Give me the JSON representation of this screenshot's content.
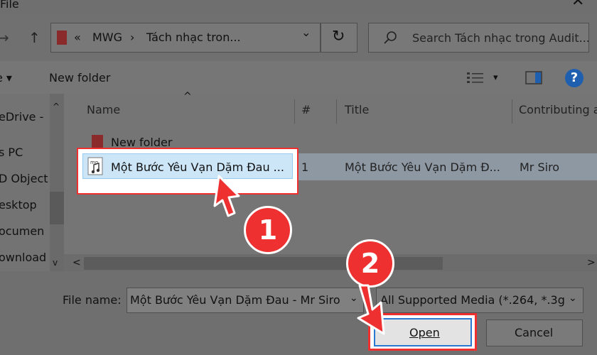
{
  "window": {
    "title": "File",
    "close": "✕"
  },
  "nav": {
    "back": "←",
    "forward": "→",
    "up": "↑"
  },
  "address": {
    "chevron": "«",
    "seg1": "MWG",
    "sep": "›",
    "seg2": "Tách nhạc tron...",
    "dropdown": "⌄",
    "refresh": "↻"
  },
  "search": {
    "placeholder": "Search Tách nhạc trong Audit..."
  },
  "toolbar": {
    "organize": "e ▾",
    "new_folder": "New folder",
    "view_menu": "▾",
    "help": "?"
  },
  "sidebar": {
    "items": [
      "eDrive -",
      "s PC",
      "D Object",
      "esktop",
      "ocumen",
      "ownload"
    ]
  },
  "columns": {
    "name": "Name",
    "num": "#",
    "title": "Title",
    "contributing": "Contributing a"
  },
  "files": [
    {
      "name": "New folder",
      "num": "",
      "title": "",
      "artist": "",
      "type": "folder"
    },
    {
      "name": "Một Bước Yêu Vạn Dặm Đau ...",
      "num": "1",
      "title": "Một Bước Yêu Vạn Dặm Đ...",
      "artist": "Mr Siro",
      "type": "audio"
    }
  ],
  "scroll": {
    "left": "<",
    "right": ">",
    "up": "^",
    "down": "v"
  },
  "footer": {
    "filename_label": "File name:",
    "filename_value": "Một Bước Yêu Vạn Dặm Đau - Mr Siro",
    "filetype_value": "All Supported Media (*.264, *.3g",
    "open": "Open",
    "cancel": "Cancel"
  },
  "annotations": {
    "step1": "1",
    "step2": "2"
  },
  "colors": {
    "accent": "#ee3130",
    "focus": "#2a78d2",
    "help": "#1f5fb0"
  }
}
